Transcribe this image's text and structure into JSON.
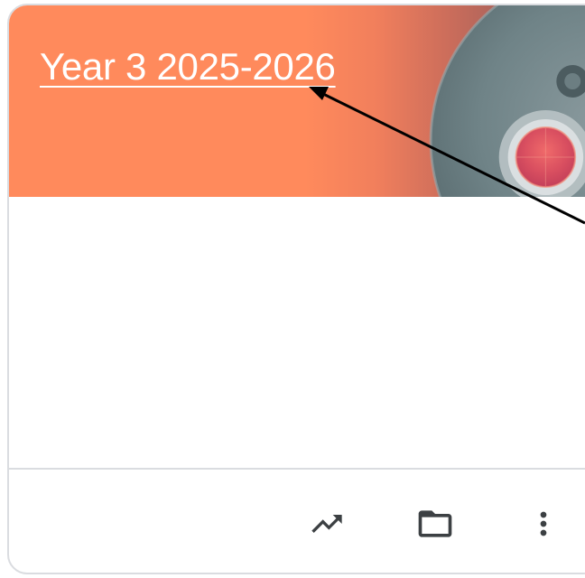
{
  "card": {
    "title": "Year 3 2025-2026",
    "banner_color": "#ff8a5c"
  },
  "footer": {
    "actions": [
      {
        "id": "trending",
        "icon": "trending-up-icon"
      },
      {
        "id": "folder",
        "icon": "folder-icon"
      },
      {
        "id": "more",
        "icon": "more-vert-icon"
      }
    ]
  },
  "colors": {
    "border": "#dadce0",
    "icon": "#3c4043",
    "annotation_arrow": "#000000"
  }
}
